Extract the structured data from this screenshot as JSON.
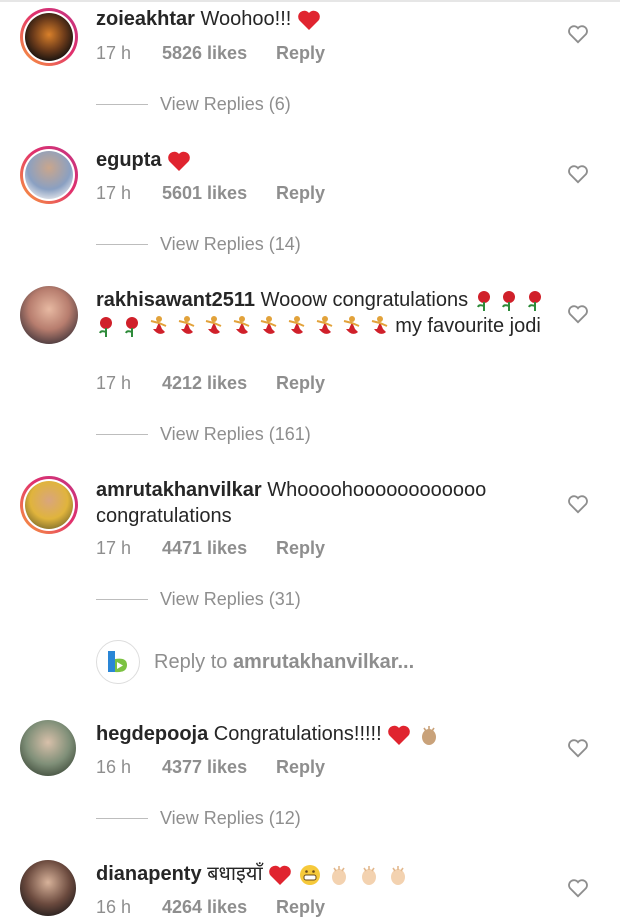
{
  "comments": [
    {
      "username": "zoieakhtar",
      "text": "Woohoo!!!",
      "time": "17 h",
      "likes": "5826 likes",
      "reply": "Reply",
      "view_replies": "View Replies (6)"
    },
    {
      "username": "egupta",
      "text": "",
      "time": "17 h",
      "likes": "5601 likes",
      "reply": "Reply",
      "view_replies": "View Replies (14)"
    },
    {
      "username": "rakhisawant2511",
      "text": "Wooow congratulations",
      "text_after_emoji": "my favourite jodi",
      "time": "17 h",
      "likes": "4212 likes",
      "reply": "Reply",
      "view_replies": "View Replies (161)"
    },
    {
      "username": "amrutakhanvilkar",
      "text": "Whoooohoooooooooooo congratulations",
      "time": "17 h",
      "likes": "4471 likes",
      "reply": "Reply",
      "view_replies": "View Replies (31)"
    },
    {
      "username": "hegdepooja",
      "text": "Congratulations!!!!!",
      "time": "16 h",
      "likes": "4377 likes",
      "reply": "Reply",
      "view_replies": "View Replies (12)"
    },
    {
      "username": "dianapenty",
      "text": "बधाइयाँ",
      "time": "16 h",
      "likes": "4264 likes",
      "reply": "Reply"
    }
  ],
  "reply_prompt": {
    "prefix": "Reply to",
    "target": "amrutakhanvilkar..."
  },
  "colors": {
    "heart_red": "#e0242f",
    "meta_gray": "#8e8e8e",
    "text": "#262626"
  },
  "icons": {
    "like": "heart-outline-icon",
    "heart_emoji": "red-heart-icon",
    "rose": "rose-icon",
    "dancer": "dancer-icon",
    "clap": "clapping-hands-icon",
    "grin": "grinning-face-icon"
  }
}
